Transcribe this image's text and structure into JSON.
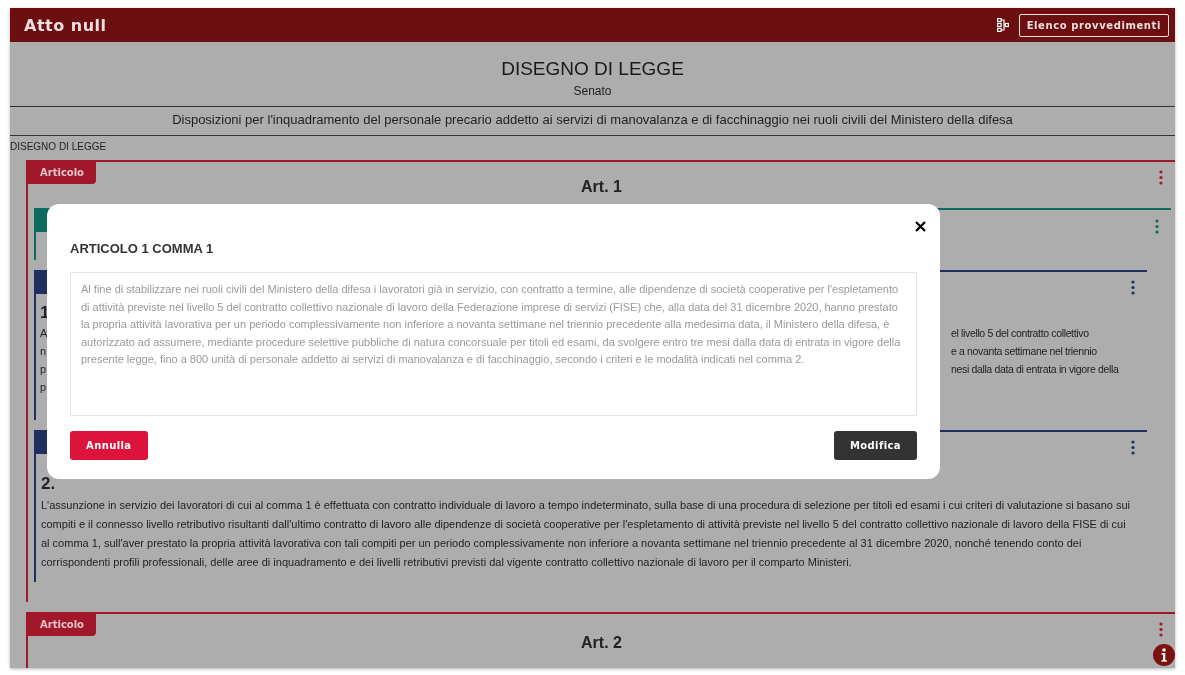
{
  "header": {
    "title": "Atto null",
    "button": "Elenco provvedimenti"
  },
  "document": {
    "title": "DISEGNO DI LEGGE",
    "chamber": "Senato",
    "subtitle": "Disposizioni per l'inquadramento del personale precario addetto ai servizi di manovalanza e di facchinaggio nei ruoli civili del Ministero della difesa",
    "section_label": "DISEGNO DI LEGGE"
  },
  "articles": [
    {
      "tab": "Articolo",
      "heading": "Art. 1",
      "commi": [
        {
          "kind": "blank",
          "color": "#0d6a5e"
        },
        {
          "kind": "partial",
          "color": "#1f2f62",
          "number": "1",
          "left_fragments": [
            "A",
            "n",
            "p",
            "p"
          ],
          "right_fragments": [
            "el livello 5 del contratto collettivo",
            "e a novanta settimane nel triennio",
            "nesi dalla data di entrata in vigore della"
          ]
        },
        {
          "kind": "full",
          "color": "#1f2f62",
          "number": "2.",
          "text": "L'assunzione in servizio dei lavoratori di cui al comma 1 è effettuata con contratto individuale di lavoro a tempo indeterminato, sulla base di una procedura di selezione per titoli ed esami i cui criteri di valutazione si basano sui compiti e il connesso livello retributivo risultanti dall'ultimo contratto di lavoro alle dipendenze di società cooperative per l'espletamento di attività previste nel livello 5 del contratto collettivo nazionale di lavoro della FISE di cui al comma 1, sull'aver prestato la propria attività lavorativa con tali compiti per un periodo complessivamente non inferiore a novanta settimane nel triennio precedente al 31 dicembre 2020, nonché tenendo conto dei corrispondenti profili professionali, delle aree di inquadramento e dei livelli retributivi previsti dal vigente contratto collettivo nazionale di lavoro per il comparto Ministeri."
        }
      ]
    },
    {
      "tab": "Articolo",
      "heading": "Art. 2"
    }
  ],
  "modal": {
    "title": "ARTICOLO 1 COMMA 1",
    "value": "Al fine di stabilizzare nei ruoli civili del Ministero della difesa i lavoratori già in servizio, con contratto a termine, alle dipendenze di società cooperative per l'espletamento di attività previste nel livello 5 del contratto collettivo nazionale di lavoro della Federazione imprese di servizi (FISE) che, alla data del 31 dicembre 2020, hanno prestato la propria attività lavorativa per un periodo complessivamente non inferiore a novanta settimane nel triennio precedente alla medesima data, il Ministero della difesa, è autorizzato ad assumere, mediante procedure selettive pubbliche di natura concorsuale per titoli ed esami, da svolgere entro tre mesi dalla data di entrata in vigore della presente legge, fino a 800 unità di personale addetto ai servizi di manovalanza e di facchinaggio, secondo i criteri e le modalità indicati nel comma 2.",
    "buttons": [
      {
        "kind": "cancel",
        "label": "Annulla"
      },
      {
        "kind": "confirm",
        "label": "Modifica"
      }
    ]
  }
}
